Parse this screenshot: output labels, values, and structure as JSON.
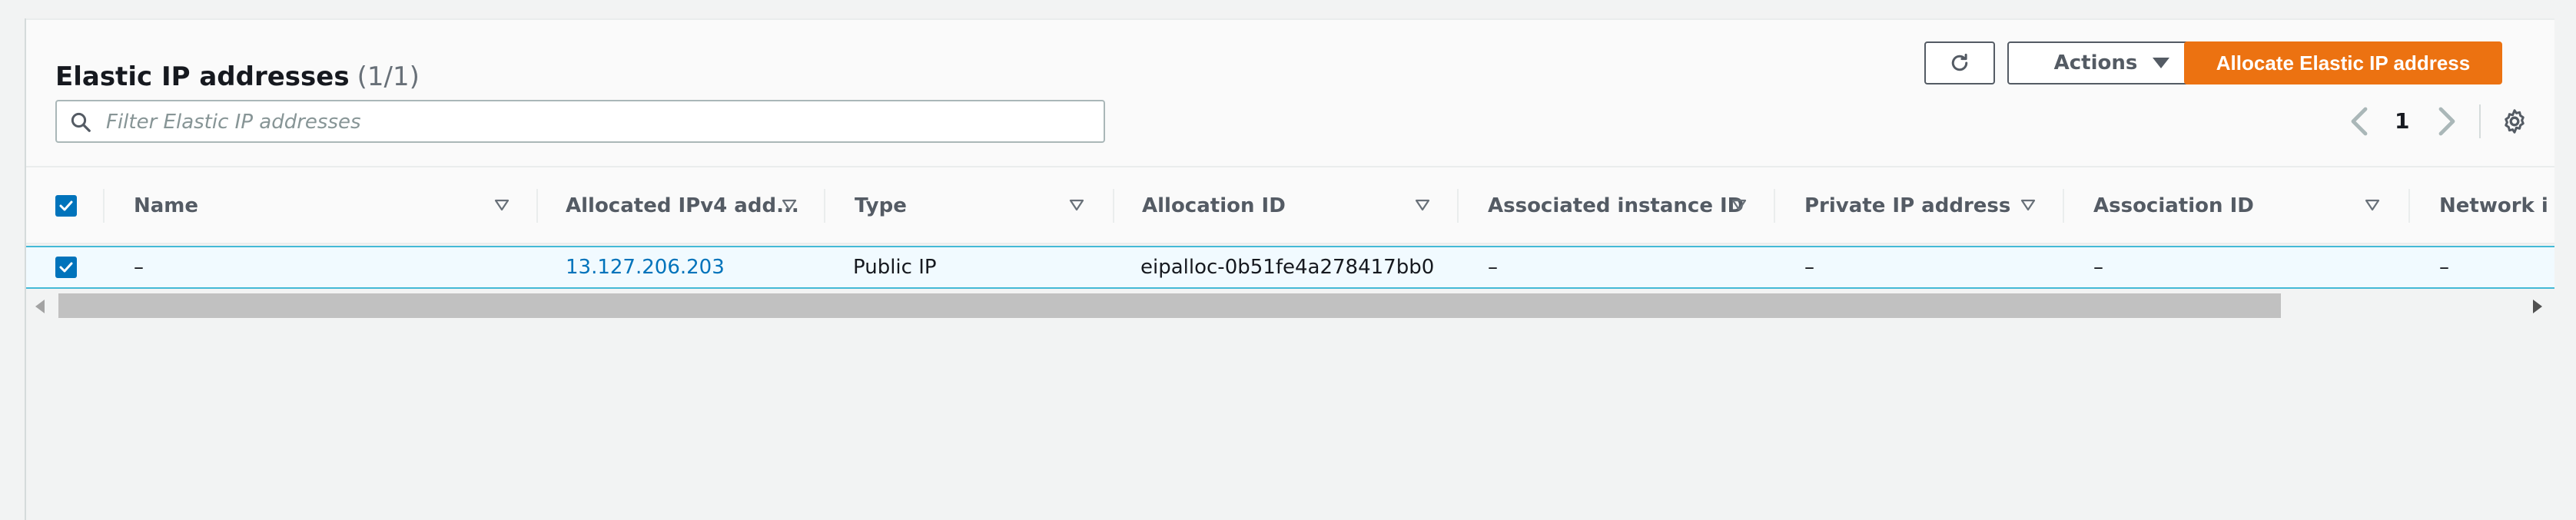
{
  "header": {
    "title": "Elastic IP addresses",
    "count": "(1/1)"
  },
  "toolbar": {
    "refresh_icon": "refresh-icon",
    "actions_label": "Actions",
    "allocate_label": "Allocate Elastic IP address"
  },
  "search": {
    "placeholder": "Filter Elastic IP addresses",
    "value": ""
  },
  "pagination": {
    "current_page": "1"
  },
  "table": {
    "columns": [
      "Name",
      "Allocated IPv4 add...",
      "Type",
      "Allocation ID",
      "Associated instance ID",
      "Private IP address",
      "Association ID",
      "Network i"
    ],
    "rows": [
      {
        "selected": true,
        "name": "–",
        "allocated_ipv4": "13.127.206.203",
        "type": "Public IP",
        "allocation_id": "eipalloc-0b51fe4a278417bb0",
        "associated_instance_id": "–",
        "private_ip": "–",
        "association_id": "–",
        "network": "–"
      }
    ]
  },
  "colors": {
    "accent": "#ec7211",
    "link": "#0073bb",
    "selected_row_bg": "#f1faff",
    "selected_row_border": "#44b9d6"
  }
}
